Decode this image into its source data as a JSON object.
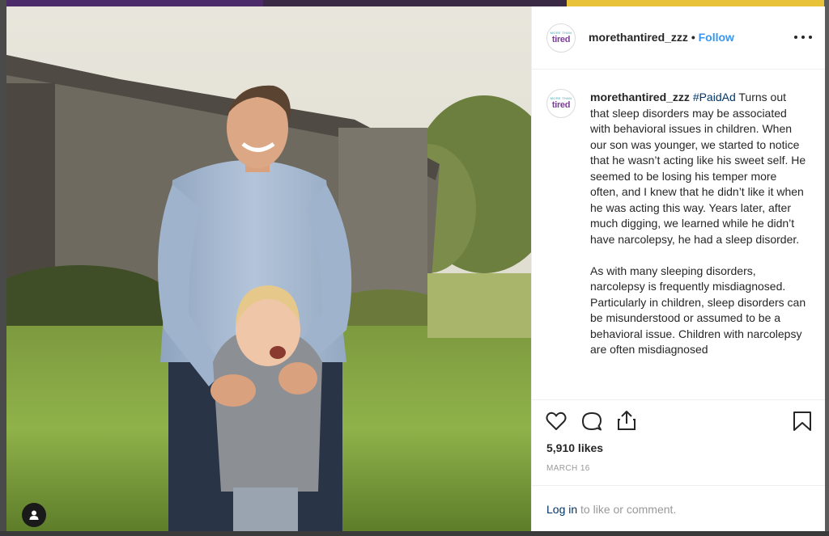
{
  "post": {
    "username": "morethantired_zzz",
    "separator": "•",
    "follow_label": "Follow",
    "avatar_brand_top": "MORE THAN",
    "avatar_brand": "tired",
    "hashtag": "#PaidAd",
    "caption_p1": "Turns out that sleep disorders may be associated with behavioral issues in children. When our son was younger, we started to notice that he wasn’t acting like his sweet self. He seemed to be losing his temper more often, and I knew that he didn’t like it when he was acting this way. Years later, after much digging, we learned while he didn’t have narcolepsy, he had a sleep disorder.",
    "caption_p2": "As with many sleeping disorders, narcolepsy is frequently misdiagnosed. Particularly in children, sleep disorders can be misunderstood or assumed to be a behavioral issue. Children with narcolepsy are often misdiagnosed",
    "likes": "5,910 likes",
    "date": "MARCH 16",
    "login_link": "Log in",
    "login_rest": " to like or comment."
  },
  "icons": {
    "more": "more-options-icon",
    "like": "heart-icon",
    "comment": "comment-icon",
    "share": "share-icon",
    "save": "bookmark-icon",
    "user_tag": "user-tag-icon"
  },
  "colors": {
    "link_blue": "#3897f0",
    "hashtag": "#003569",
    "brand_purple": "#7b3f98",
    "brand_teal": "#2fa3b5",
    "muted": "#999999",
    "text": "#262626"
  }
}
